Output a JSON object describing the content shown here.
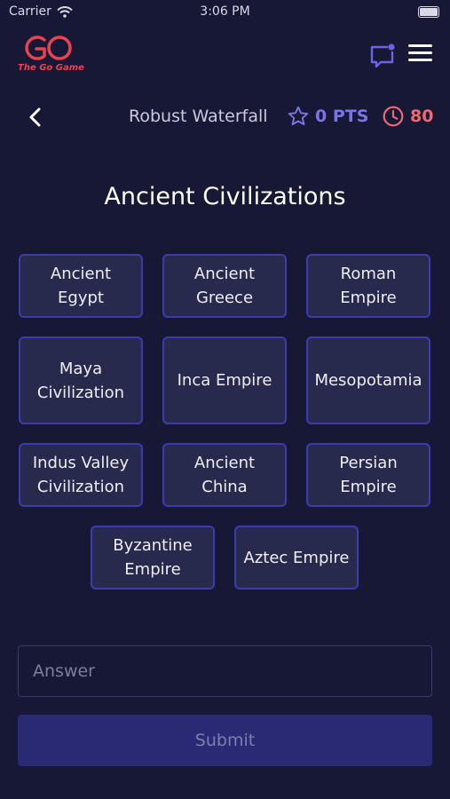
{
  "status_bar": {
    "carrier": "Carrier",
    "time": "3:06 PM"
  },
  "header": {
    "logo_text": "The Go Game"
  },
  "game_bar": {
    "team_name": "Robust Waterfall",
    "points": "0 PTS",
    "timer": "80"
  },
  "question": {
    "title": "Ancient Civilizations"
  },
  "options": [
    "Ancient Egypt",
    "Ancient Greece",
    "Roman Empire",
    "Maya Civilization",
    "Inca Empire",
    "Mesopotamia",
    "Indus Valley Civilization",
    "Ancient China",
    "Persian Empire",
    "Byzantine Empire",
    "Aztec Empire"
  ],
  "answer": {
    "placeholder": "Answer",
    "value": ""
  },
  "submit": {
    "label": "Submit"
  },
  "colors": {
    "background": "#161836",
    "tile_background": "#272a4c",
    "tile_border": "#3e3ab0",
    "brand_red": "#e8434f",
    "points_purple": "#7b74e6",
    "timer_red": "#ef6a72",
    "submit_background": "#2a2974"
  },
  "icons": [
    "wifi-icon",
    "battery-icon",
    "go-game-logo",
    "chat-icon",
    "menu-icon",
    "back-arrow-icon",
    "star-icon",
    "clock-icon"
  ]
}
